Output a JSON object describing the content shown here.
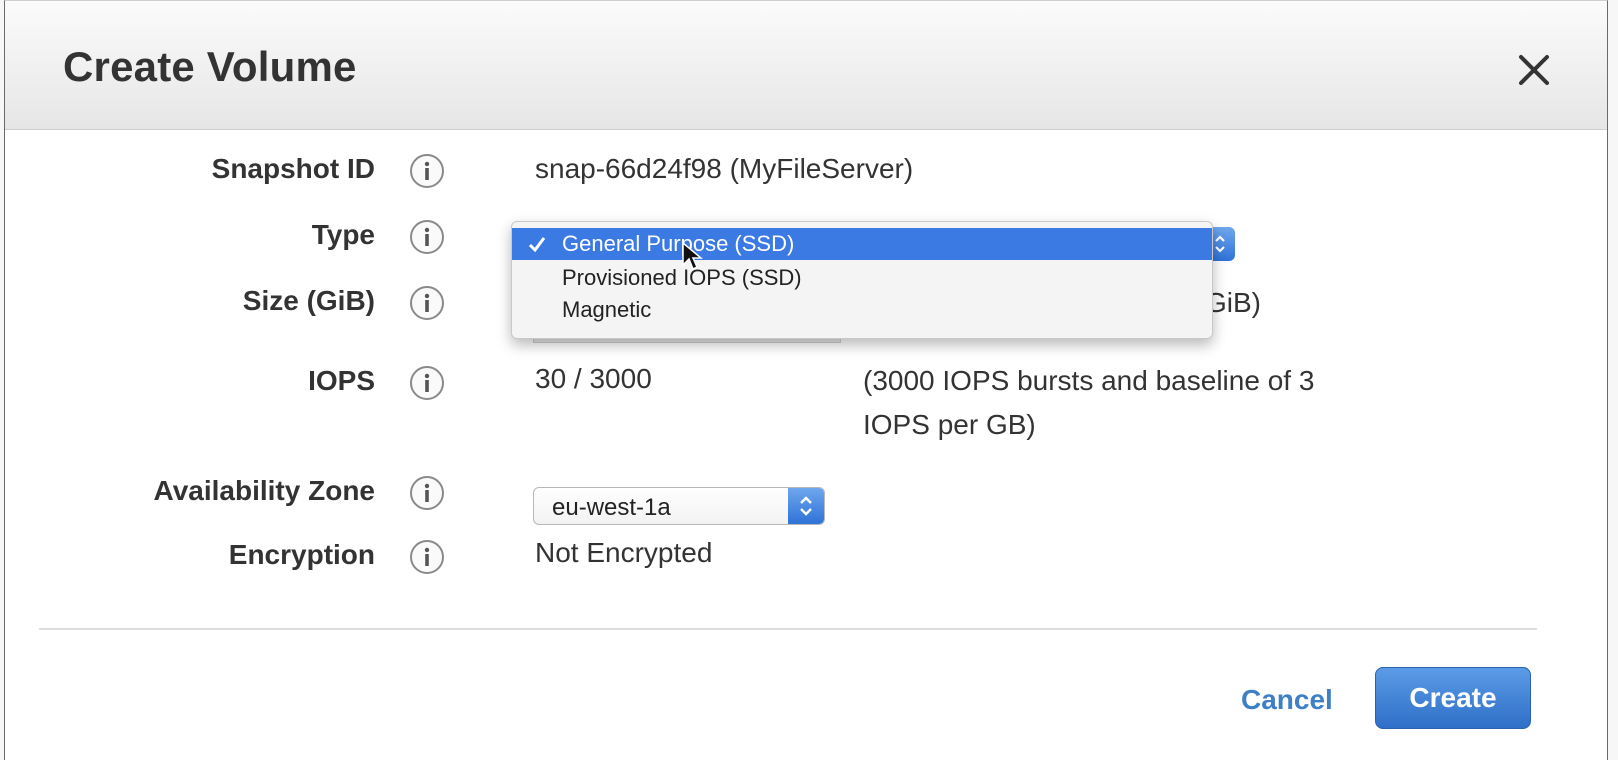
{
  "dialog": {
    "title": "Create Volume",
    "close_icon": "close-icon"
  },
  "fields": {
    "snapshot": {
      "label": "Snapshot ID",
      "value": "snap-66d24f98 (MyFileServer)"
    },
    "type": {
      "label": "Type",
      "selected": "General Purpose (SSD)",
      "options": [
        "General Purpose (SSD)",
        "Provisioned IOPS (SSD)",
        "Magnetic"
      ]
    },
    "size": {
      "label": "Size (GiB)",
      "note_fragment": "GiB)"
    },
    "iops": {
      "label": "IOPS",
      "value": "30 / 3000",
      "note_line1": "(3000 IOPS bursts and baseline of 3",
      "note_line2": "IOPS per GB)"
    },
    "availability_zone": {
      "label": "Availability Zone",
      "selected": "eu-west-1a"
    },
    "encryption": {
      "label": "Encryption",
      "value": "Not Encrypted"
    }
  },
  "footer": {
    "cancel_label": "Cancel",
    "create_label": "Create"
  },
  "colors": {
    "accent": "#3b79e3",
    "link": "#3f7fc6",
    "button": "#2f6fc8"
  }
}
